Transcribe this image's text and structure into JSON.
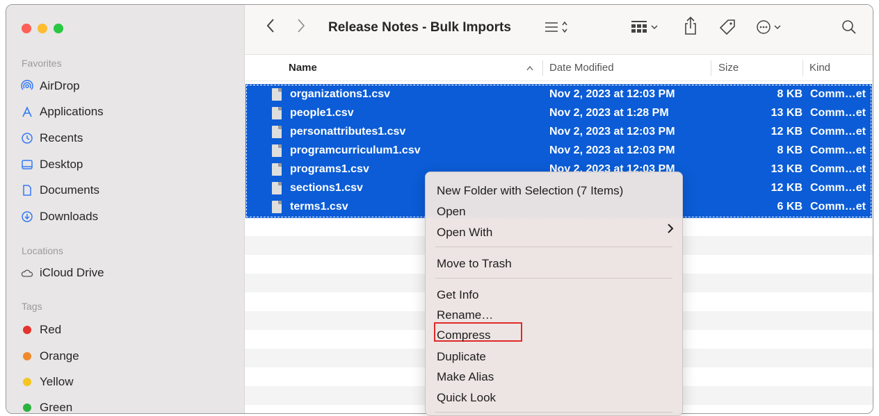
{
  "sidebar": {
    "sections": {
      "favorites": "Favorites",
      "locations": "Locations",
      "tags": "Tags"
    },
    "favorites": [
      {
        "label": "AirDrop",
        "icon": "airdrop-icon"
      },
      {
        "label": "Applications",
        "icon": "applications-icon"
      },
      {
        "label": "Recents",
        "icon": "clock-icon"
      },
      {
        "label": "Desktop",
        "icon": "desktop-icon"
      },
      {
        "label": "Documents",
        "icon": "document-icon"
      },
      {
        "label": "Downloads",
        "icon": "download-icon"
      }
    ],
    "locations": [
      {
        "label": "iCloud Drive",
        "icon": "cloud-icon"
      }
    ],
    "tags": [
      {
        "label": "Red",
        "color": "#e5332d"
      },
      {
        "label": "Orange",
        "color": "#f0892b"
      },
      {
        "label": "Yellow",
        "color": "#f5c521"
      },
      {
        "label": "Green",
        "color": "#2cb33f"
      }
    ]
  },
  "toolbar": {
    "title": "Release Notes - Bulk Imports"
  },
  "columns": {
    "name": "Name",
    "date": "Date Modified",
    "size": "Size",
    "kind": "Kind"
  },
  "files": [
    {
      "name": "organizations1.csv",
      "date": "Nov 2, 2023 at 12:03 PM",
      "size": "8 KB",
      "kind": "Comm…et"
    },
    {
      "name": "people1.csv",
      "date": "Nov 2, 2023 at 1:28 PM",
      "size": "13 KB",
      "kind": "Comm…et"
    },
    {
      "name": "personattributes1.csv",
      "date": "Nov 2, 2023 at 12:03 PM",
      "size": "12 KB",
      "kind": "Comm…et"
    },
    {
      "name": "programcurriculum1.csv",
      "date": "Nov 2, 2023 at 12:03 PM",
      "size": "8 KB",
      "kind": "Comm…et"
    },
    {
      "name": "programs1.csv",
      "date": "Nov 2, 2023 at 12:03 PM",
      "size": "13 KB",
      "kind": "Comm…et"
    },
    {
      "name": "sections1.csv",
      "date": "",
      "size": "12 KB",
      "kind": "Comm…et"
    },
    {
      "name": "terms1.csv",
      "date": "",
      "size": "6 KB",
      "kind": "Comm…et"
    }
  ],
  "context_menu": {
    "new_folder": "New Folder with Selection (7 Items)",
    "open": "Open",
    "open_with": "Open With",
    "move_to_trash": "Move to Trash",
    "get_info": "Get Info",
    "rename": "Rename…",
    "compress": "Compress",
    "duplicate": "Duplicate",
    "make_alias": "Make Alias",
    "quick_look": "Quick Look",
    "highlight_color": "#e0292b"
  },
  "colors": {
    "selection": "#0b5cd6",
    "accent": "#3478f6"
  }
}
